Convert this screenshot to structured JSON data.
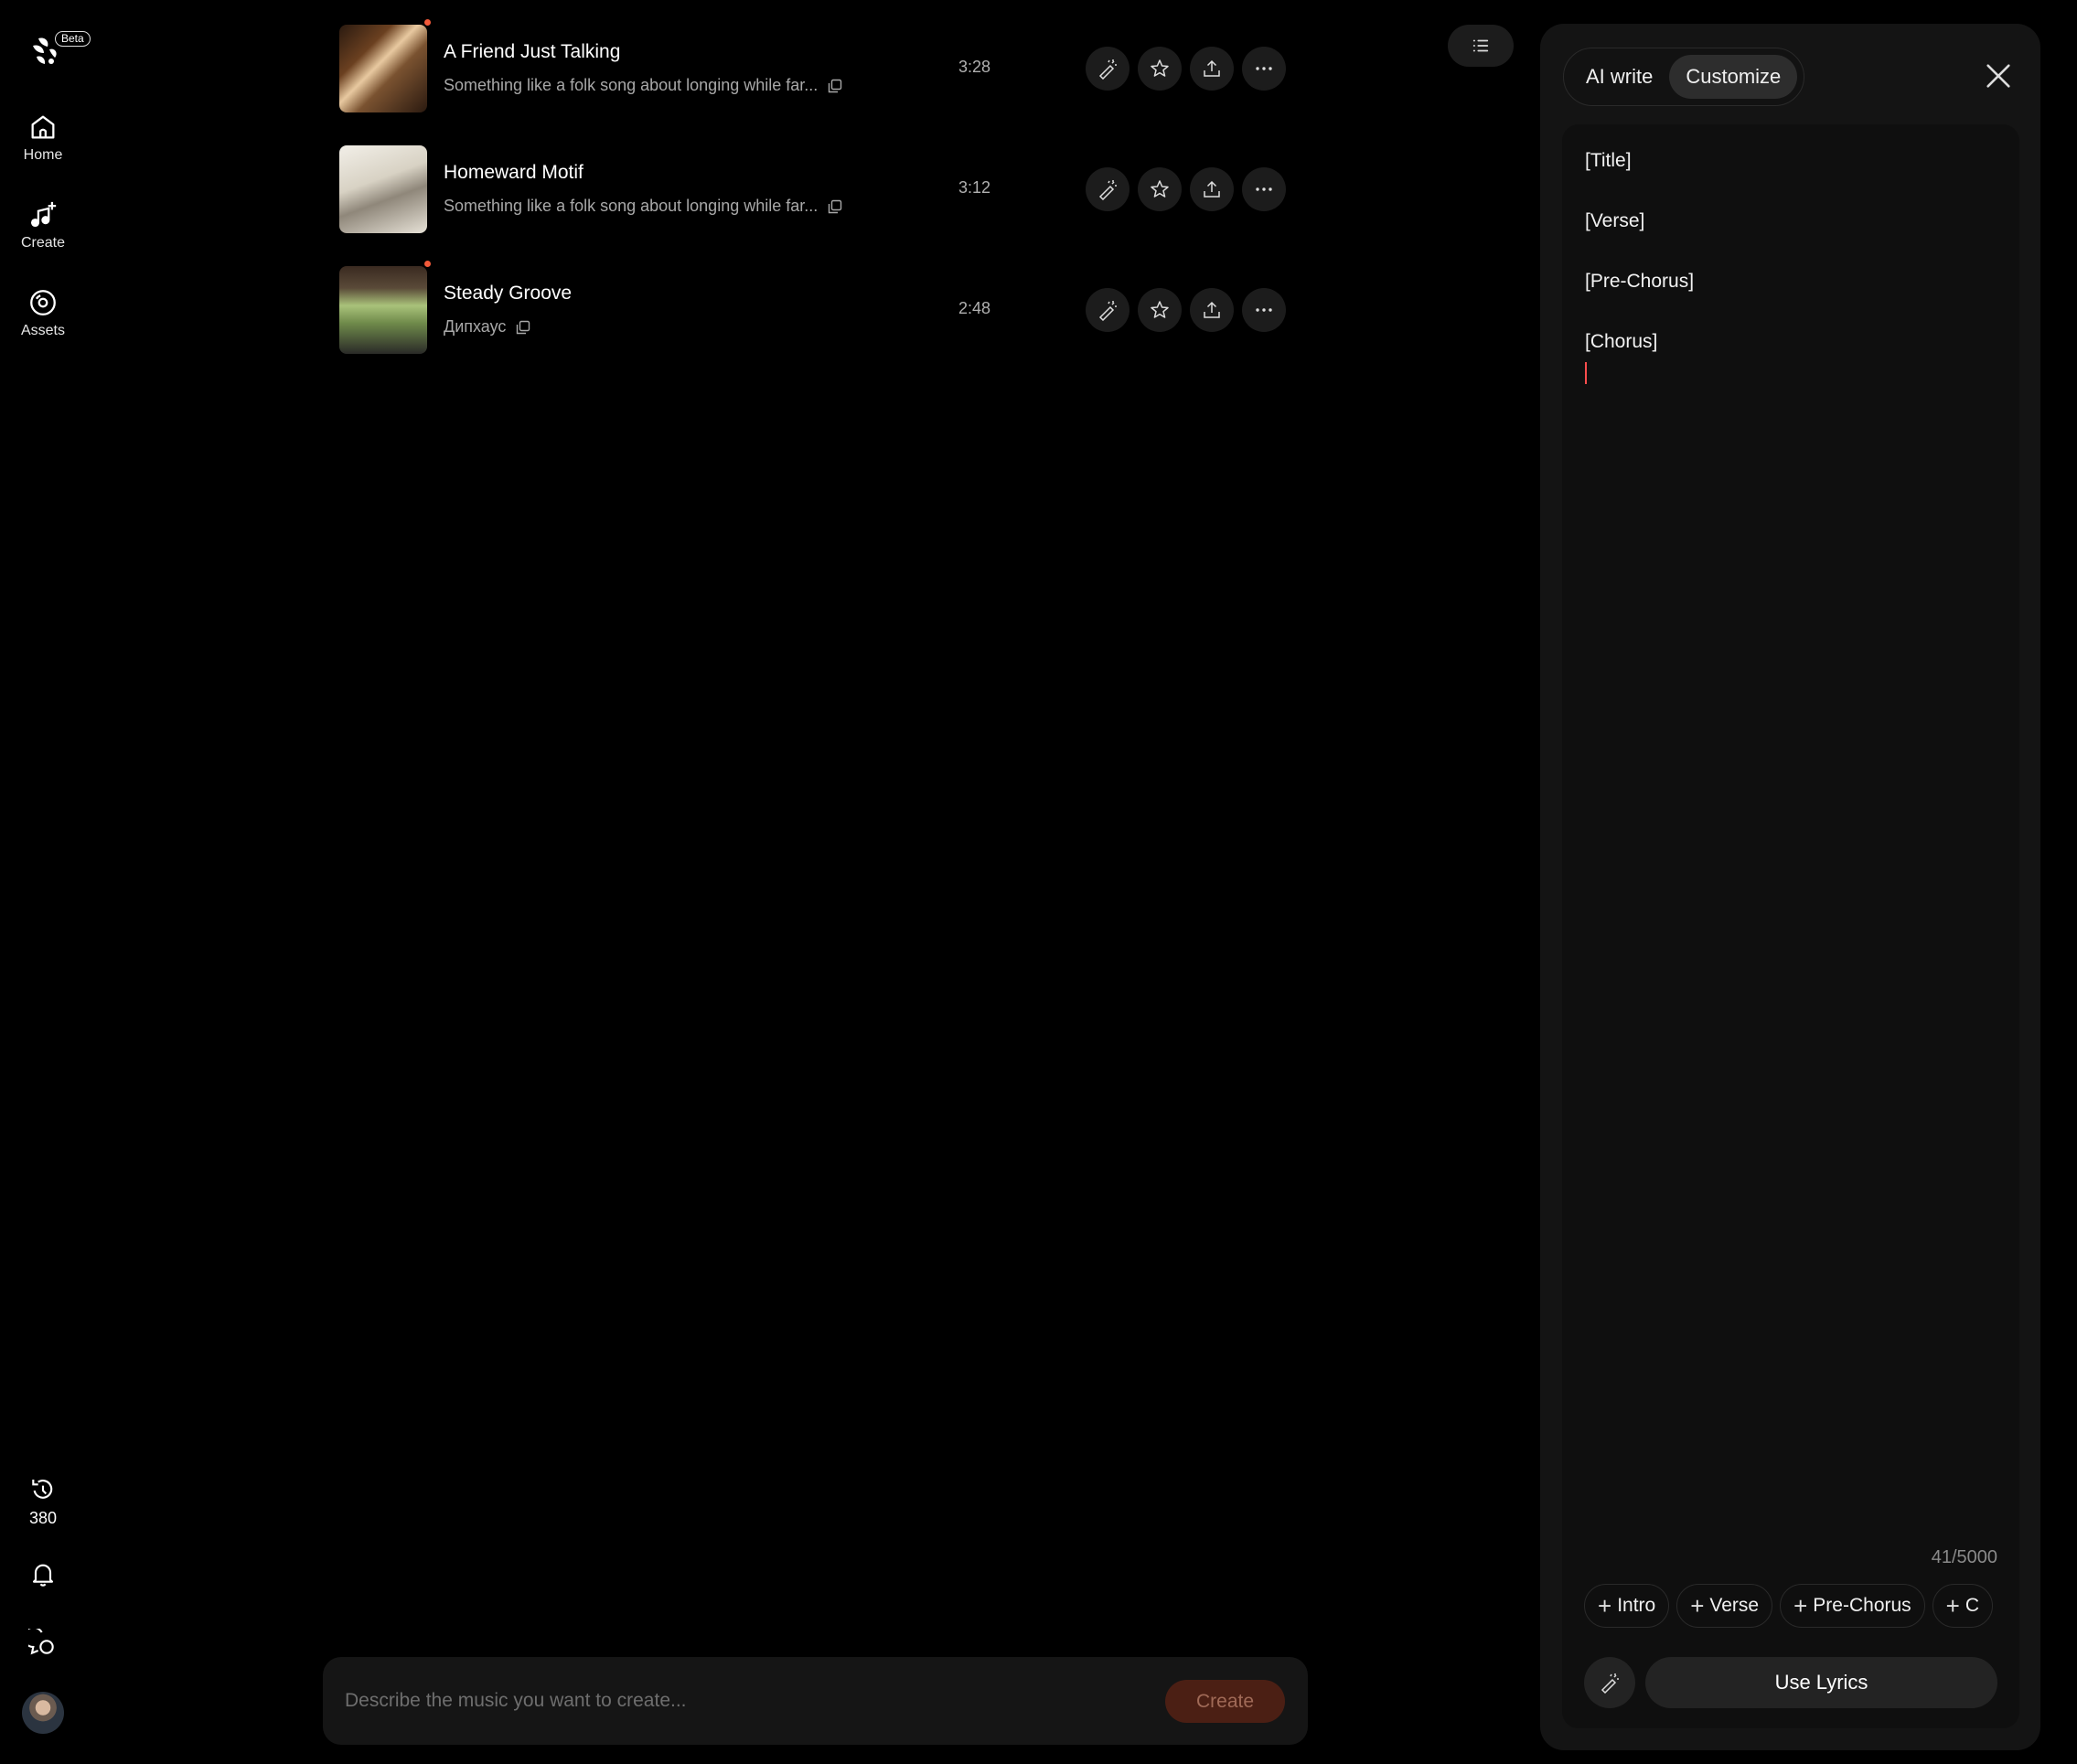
{
  "brand": {
    "badge": "Beta"
  },
  "sidebar": {
    "items": [
      {
        "label": "Home",
        "icon": "home-icon"
      },
      {
        "label": "Create",
        "icon": "music-plus-icon"
      },
      {
        "label": "Assets",
        "icon": "disc-icon"
      }
    ],
    "credits": "380"
  },
  "songs": [
    {
      "title": "A Friend Just Talking",
      "description": "Something like a folk song about longing while far...",
      "duration": "3:28",
      "is_new": true
    },
    {
      "title": "Homeward Motif",
      "description": "Something like a folk song about longing while far...",
      "duration": "3:12",
      "is_new": false
    },
    {
      "title": "Steady Groove",
      "description": "Дипхаус",
      "duration": "2:48",
      "is_new": true
    }
  ],
  "prompt": {
    "placeholder": "Describe the music you want to create...",
    "create_label": "Create"
  },
  "lyrics_panel": {
    "tabs": [
      {
        "label": "AI write",
        "active": false
      },
      {
        "label": "Customize",
        "active": true
      }
    ],
    "lines": [
      "[Title]",
      "[Verse]",
      "[Pre-Chorus]",
      "[Chorus]"
    ],
    "counter": "41/5000",
    "chips": [
      "Intro",
      "Verse",
      "Pre-Chorus",
      "C"
    ],
    "use_label": "Use Lyrics"
  },
  "colors": {
    "accent": "#ff4d4d",
    "create_button_bg": "#4b1f14",
    "panel_bg": "#141414"
  }
}
